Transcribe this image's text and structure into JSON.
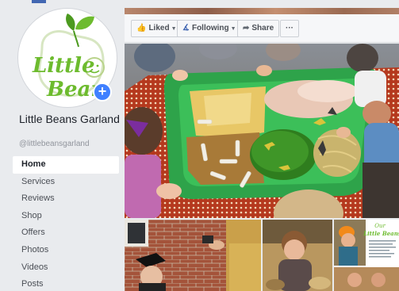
{
  "page": {
    "name": "Little Beans Garland",
    "username": "@littlebeansgarland",
    "logo_text_line1": "Little",
    "logo_text_line2": "Beans"
  },
  "actions": {
    "liked_label": "Liked",
    "following_label": "Following",
    "share_label": "Share",
    "more_label": "···"
  },
  "nav": {
    "items": [
      {
        "label": "Home",
        "active": true
      },
      {
        "label": "Services"
      },
      {
        "label": "Reviews"
      },
      {
        "label": "Shop"
      },
      {
        "label": "Offers"
      },
      {
        "label": "Photos"
      },
      {
        "label": "Videos"
      },
      {
        "label": "Posts"
      }
    ]
  },
  "thumbs": {
    "flyer_title_line1": "Our",
    "flyer_title_line2": "Little Beans"
  },
  "colors": {
    "brand_blue": "#4267b2",
    "logo_green": "#6dbb2e",
    "sidebar_bg": "#e9ebee"
  }
}
